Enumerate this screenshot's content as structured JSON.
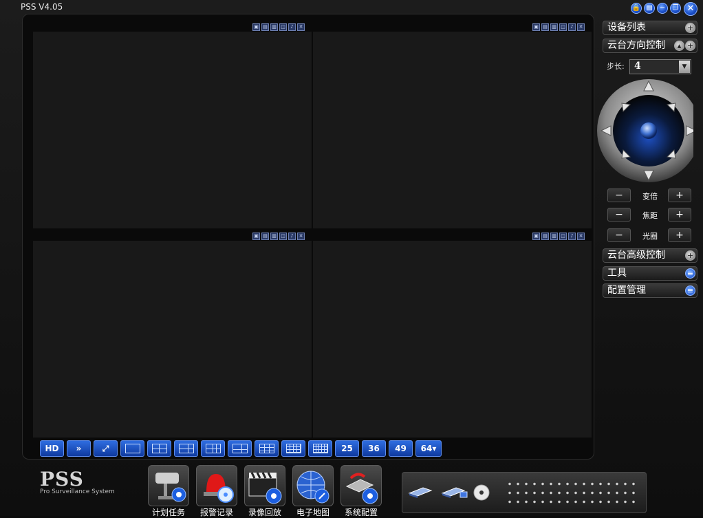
{
  "app": {
    "title": "PSS  V4.05"
  },
  "title_buttons": [
    {
      "name": "lock",
      "glyph": "🔒"
    },
    {
      "name": "menu",
      "glyph": "▤"
    },
    {
      "name": "minimize",
      "glyph": "−"
    },
    {
      "name": "restore",
      "glyph": "❐"
    },
    {
      "name": "close",
      "glyph": "✕"
    }
  ],
  "pane_toolbar_glyphs": [
    "▣",
    "▤",
    "▥",
    "◫",
    "♪",
    "✕"
  ],
  "layout_buttons": [
    {
      "label": "HD"
    },
    {
      "label": "»"
    },
    {
      "label": "⤢"
    },
    {
      "label": ""
    },
    {
      "label": ""
    },
    {
      "label": ""
    },
    {
      "label": ""
    },
    {
      "label": ""
    },
    {
      "label": ""
    },
    {
      "label": ""
    },
    {
      "label": ""
    },
    {
      "label": ""
    },
    {
      "label": "25"
    },
    {
      "label": "36"
    },
    {
      "label": "49"
    },
    {
      "label": "64▾"
    }
  ],
  "right_panel": {
    "device_list": "设备列表",
    "ptz_direction": "云台方向控制",
    "step_label": "步长:",
    "step_value": "4",
    "zoom_label": "变倍",
    "focus_label": "焦距",
    "iris_label": "光圈",
    "minus": "−",
    "plus": "+",
    "ptz_advanced": "云台高级控制",
    "tools": "工具",
    "config_manage": "配置管理"
  },
  "bottom": {
    "logo_main": "PSS",
    "logo_sub": "Pro Surveillance System",
    "apps": [
      {
        "label": "计划任务"
      },
      {
        "label": "报警记录"
      },
      {
        "label": "录像回放"
      },
      {
        "label": "电子地图"
      },
      {
        "label": "系统配置"
      }
    ]
  }
}
